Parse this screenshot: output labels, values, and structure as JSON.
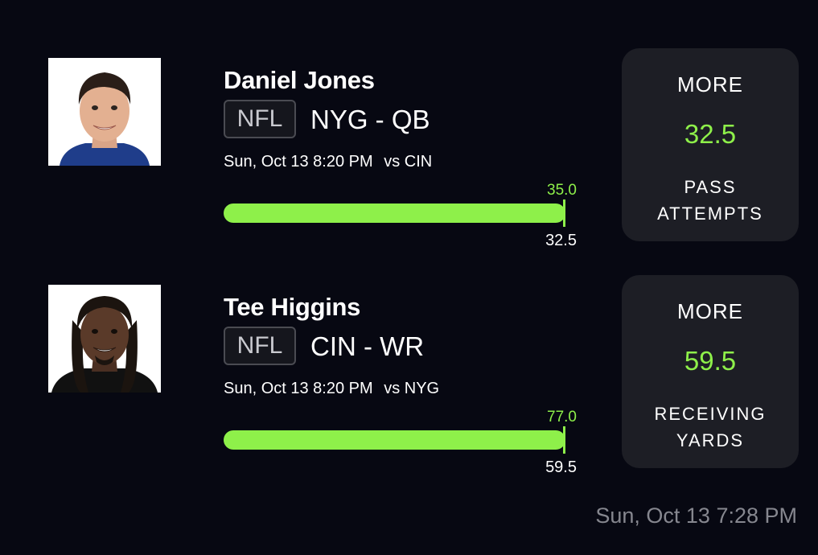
{
  "picks": [
    {
      "player_name": "Daniel Jones",
      "league": "NFL",
      "team_position": "NYG - QB",
      "game_time": "Sun, Oct 13 8:20 PM",
      "opponent": "vs CIN",
      "actual_value": "35.0",
      "line_value": "32.5",
      "progress_fraction": 1.0,
      "card": {
        "direction": "MORE",
        "line": "32.5",
        "stat_line1": "PASS",
        "stat_line2": "ATTEMPTS"
      },
      "jersey_color": "#1f3d8a"
    },
    {
      "player_name": "Tee Higgins",
      "league": "NFL",
      "team_position": "CIN - WR",
      "game_time": "Sun, Oct 13 8:20 PM",
      "opponent": "vs NYG",
      "actual_value": "77.0",
      "line_value": "59.5",
      "progress_fraction": 1.0,
      "card": {
        "direction": "MORE",
        "line": "59.5",
        "stat_line1": "RECEIVING",
        "stat_line2": "YARDS"
      },
      "jersey_color": "#111111"
    }
  ],
  "timestamp": "Sun, Oct 13 7:28 PM",
  "colors": {
    "accent_green": "#8ef04a",
    "background": "#070812",
    "card_bg": "#1d1e25",
    "muted_text": "#86878f"
  }
}
